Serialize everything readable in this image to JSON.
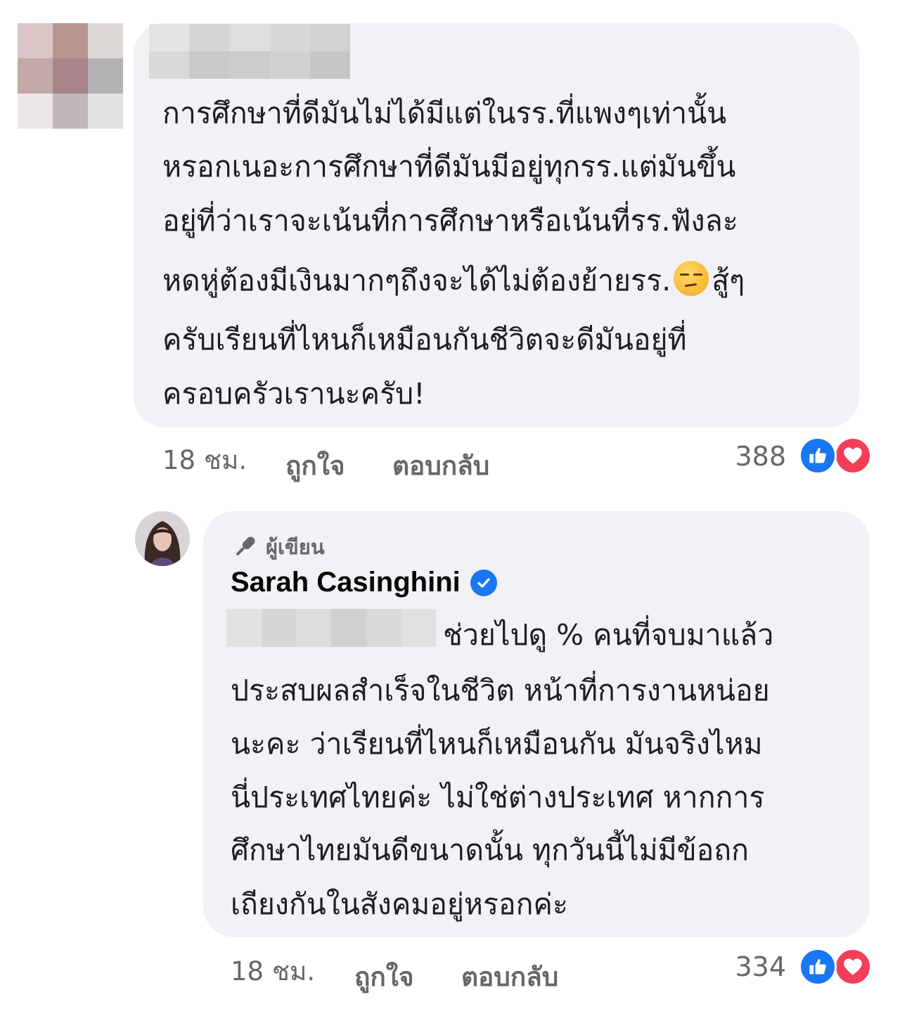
{
  "comments": [
    {
      "author_name": "",
      "text_lines": [
        "การศึกษาที่ดีมันไม่ได้มีแต่ในรร.ที่แพงๆเท่านั้น",
        "หรอกเนอะการศึกษาที่ดีมันมีอยู่ทุกรร.แต่มันขึ้น",
        "อยู่ที่ว่าเราจะเน้นที่การศึกษาหรือเน้นที่รร.ฟังละ",
        "หดหู่ต้องมีเงินมากๆถึงจะได้ไม่ต้องย้ายรร.",
        "สู้ๆ",
        "ครับเรียนที่ไหนก็เหมือนกันชีวิตจะดีมันอยู่ที่",
        "ครอบครัวเรานะครับ!"
      ],
      "emoji": "unamused-face-emoji",
      "time": "18 ชม.",
      "like_label": "ถูกใจ",
      "reply_label": "ตอบกลับ",
      "reaction_count": "388"
    },
    {
      "badge_label": "ผู้เขียน",
      "badge_icon": "microphone-icon",
      "author_name": "Sarah Casinghini",
      "verified": true,
      "text_lines": [
        "ช่วยไปดู % คนที่จบมาแล้ว",
        "ประสบผลสำเร็จในชีวิต หน้าที่การงานหน่อย",
        "นะคะ ว่าเรียนที่ไหนก็เหมือนกัน มันจริงไหม",
        "นี่ประเทศไทยค่ะ ไม่ใช่ต่างประเทศ  หากการ",
        "ศึกษาไทยมันดีขนาดนั้น ทุกวันนี้ไม่มีข้อถก",
        "เถียงกันในสังคมอยู่หรอกค่ะ"
      ],
      "time": "18 ชม.",
      "like_label": "ถูกใจ",
      "reply_label": "ตอบกลับ",
      "reaction_count": "334"
    }
  ],
  "colors": {
    "bubble": "#f0f2f5",
    "meta_text": "#65676b",
    "like_blue": "#1877f2",
    "love_red": "#f33e58"
  }
}
